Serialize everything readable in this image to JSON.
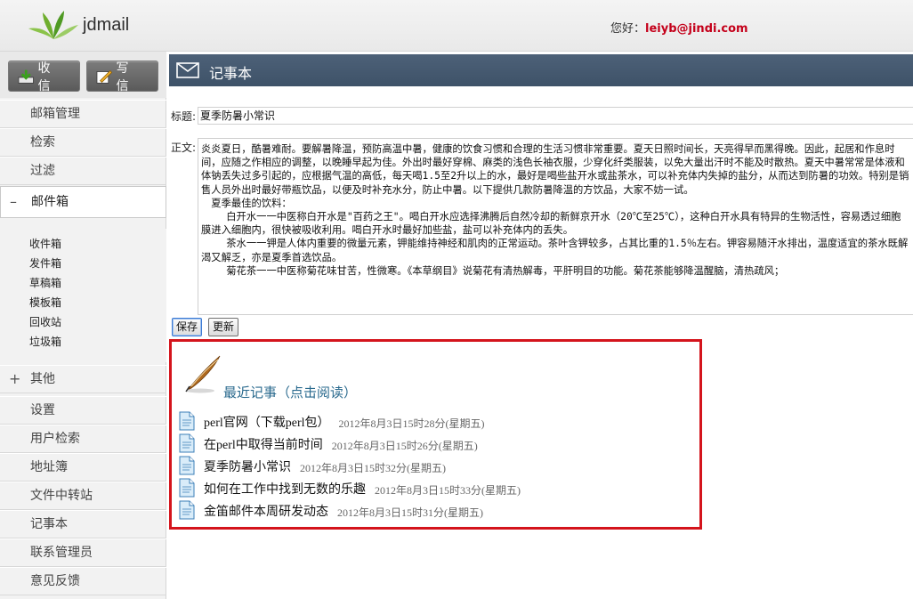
{
  "header": {
    "brand": "jdmail",
    "greeting_label": "您好：",
    "user_email": "leiyb@jindi.com"
  },
  "sidebar": {
    "receive_label": "收 信",
    "write_label": "写 信",
    "items": [
      {
        "label": "邮箱管理"
      },
      {
        "label": "检索"
      },
      {
        "label": "过滤"
      },
      {
        "label": "邮件箱",
        "marker": "–"
      },
      {
        "label": "其他",
        "marker": "+"
      },
      {
        "label": "设置"
      },
      {
        "label": "用户检索"
      },
      {
        "label": "地址簿"
      },
      {
        "label": "文件中转站"
      },
      {
        "label": "记事本"
      },
      {
        "label": "联系管理员"
      },
      {
        "label": "意见反馈"
      }
    ],
    "folders": [
      "收件箱",
      "发件箱",
      "草稿箱",
      "模板箱",
      "回收站",
      "垃圾箱"
    ]
  },
  "main": {
    "title": "记事本",
    "subject_label": "标题:",
    "subject_value": "夏季防暑小常识",
    "body_label": "正文:",
    "body_paragraphs": [
      "炎炎夏日，酷暑难耐。要解暑降温，预防高温中暑，健康的饮食习惯和合理的生活习惯非常重要。夏天日照时间长，天亮得早而黑得晚。因此，起居和作息时间，应随之作相应的调整，以晚睡早起为佳。外出时最好穿棉、麻类的浅色长袖衣服，少穿化纤类服装，以免大量出汗时不能及时散热。夏天中暑常常是体液和体钠丢失过多引起的，应根据气温的高低，每天喝1.5至2升以上的水，最好是喝些盐开水或盐茶水，可以补充体内失掉的盐分，从而达到防暑的功效。特别是销售人员外出时最好带瓶饮品，以便及时补充水分，防止中暑。以下提供几款防暑降温的方饮品，大家不妨一试。",
      "夏季最佳的饮料：",
      "白开水一一中医称白开水是\"百药之王\"。喝白开水应选择沸腾后自然冷却的新鲜京开水（20℃至25℃），这种白开水具有特异的生物活性，容易透过细胞膜进入细胞内，很快被吸收利用。喝白开水时最好加些盐，盐可以补充体内的丢失。",
      "茶水一一钾是人体内重要的微量元素，钾能维持神经和肌肉的正常运动。茶叶含钾较多，占其比重的1.5％左右。钾容易随汗水排出，温度适宜的茶水既解渴又解乏，亦是夏季首选饮品。",
      "菊花茶一一中医称菊花味甘苦，性微寒。《本草纲目》说菊花有清热解毒，平肝明目的功能。菊花茶能够降温醒脑，清热疏风；"
    ],
    "save_label": "保存",
    "update_label": "更新"
  },
  "recent": {
    "title": "最近记事（点击阅读）",
    "notes": [
      {
        "title": "perl官网（下载perl包）",
        "date": "2012年8月3日15时28分(星期五)"
      },
      {
        "title": "在perl中取得当前时间",
        "date": "2012年8月3日15时26分(星期五)"
      },
      {
        "title": "夏季防暑小常识",
        "date": "2012年8月3日15时32分(星期五)"
      },
      {
        "title": "如何在工作中找到无数的乐趣",
        "date": "2012年8月3日15时33分(星期五)"
      },
      {
        "title": "金笛邮件本周研发动态",
        "date": "2012年8月3日15时31分(星期五)"
      }
    ]
  },
  "colors": {
    "accent_header": "#43576d",
    "user_email": "#c4001a",
    "highlight_border": "#d4141c",
    "recent_title": "#2a6a8e"
  }
}
